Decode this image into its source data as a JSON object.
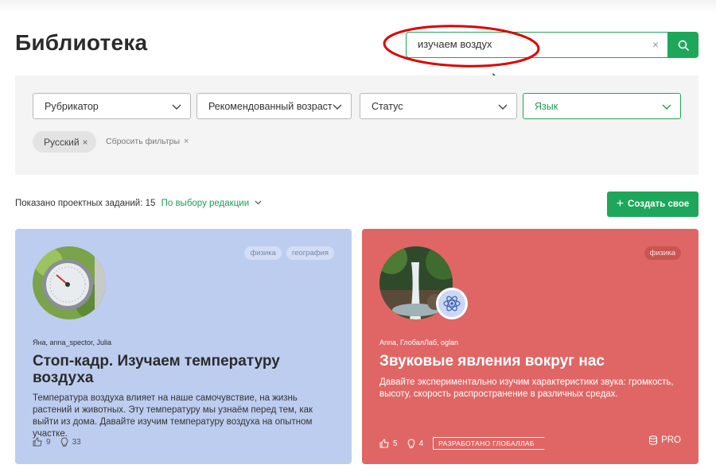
{
  "page": {
    "title": "Библиотека"
  },
  "search": {
    "value": "изучаем воздух",
    "clear_label": "×"
  },
  "filters": {
    "dropdowns": [
      {
        "label": "Рубрикатор"
      },
      {
        "label": "Рекомендованный возраст"
      },
      {
        "label": "Статус"
      },
      {
        "label": "Язык"
      }
    ],
    "active_chip": {
      "label": "Русский",
      "remove": "×"
    },
    "reset_label": "Сбросить фильтры",
    "reset_icon": "×"
  },
  "results": {
    "count_label": "Показано проектных заданий: 15",
    "sort_label": "По выбору редакции"
  },
  "create_button": {
    "plus": "+",
    "label": "Создать свое"
  },
  "cards": [
    {
      "tags": [
        "физика",
        "география"
      ],
      "authors": "Яна, anna_spector, Julia",
      "title": "Стоп-кадр. Изучаем температуру воздуха",
      "description": "Температура воздуха влияет на наше самочувствие, на жизнь растений и животных. Эту температуру мы узнаём перед тем, как выйти из дома. Давайте изучим температуру воздуха на опытном участке.",
      "likes": "9",
      "ideas": "33",
      "background": "#bdcdf0"
    },
    {
      "tags": [
        "физика"
      ],
      "authors": "Anna, ГлобалЛаб, oglan",
      "title": "Звуковые явления вокруг нас",
      "description": "Давайте экспериментально изучим характеристики звука: громкость, высоту, скорость распространение в различных средах.",
      "likes": "5",
      "ideas": "4",
      "developed_badge": "РАЗРАБОТАНО ГЛОБАЛЛАБ",
      "pro_label": "PRO",
      "background": "#df6664"
    }
  ],
  "colors": {
    "accent": "#1ea75a",
    "annotation": "#e00000"
  }
}
